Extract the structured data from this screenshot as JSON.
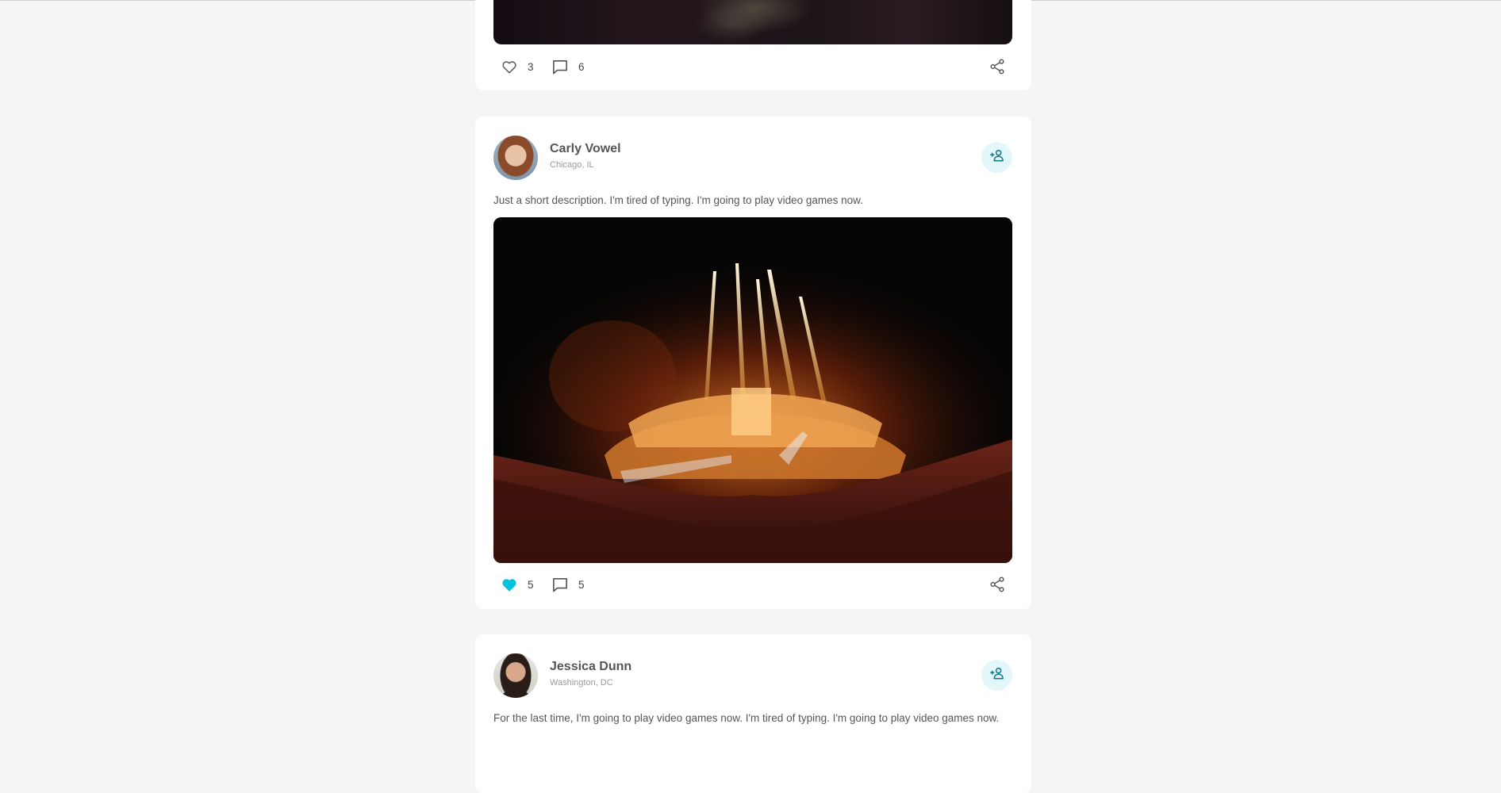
{
  "posts": [
    {
      "likes": "3",
      "comments": "6",
      "liked": false
    },
    {
      "author": "Carly Vowel",
      "location": "Chicago, IL",
      "description": "Just a short description. I'm tired of typing. I'm going to play video games now.",
      "likes": "5",
      "comments": "5",
      "liked": true
    },
    {
      "author": "Jessica Dunn",
      "location": "Washington, DC",
      "description": "For the last time, I'm going to play video games now. I'm tired of typing. I'm going to play video games now."
    }
  ],
  "icons": {
    "like": "heart-icon",
    "comment": "comment-icon",
    "share": "share-icon",
    "follow": "add-user-icon"
  },
  "colors": {
    "accent": "#00c2dd",
    "follow_bg": "#e3f7fa",
    "follow_icon": "#177c8a",
    "page_bg": "#f5f5f5",
    "card_bg": "#ffffff"
  }
}
